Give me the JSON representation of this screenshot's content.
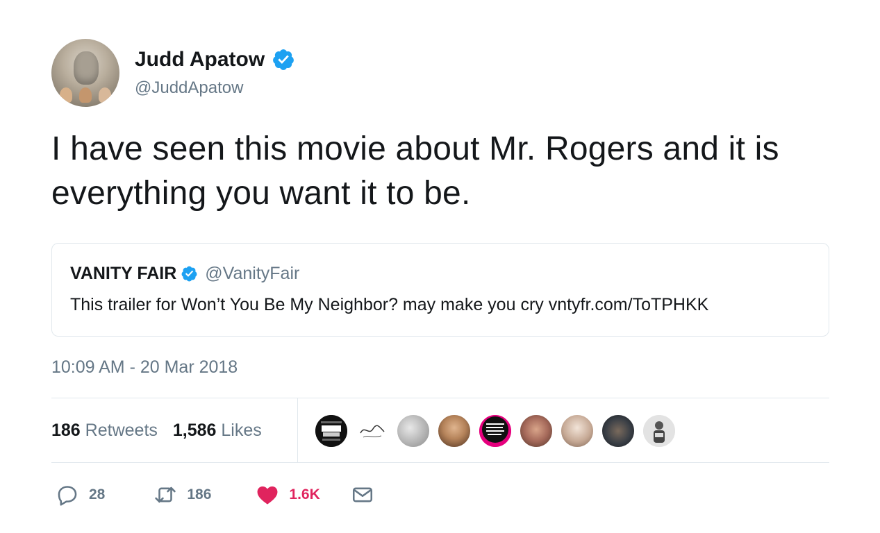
{
  "author": {
    "name": "Judd Apatow",
    "handle": "@JuddApatow",
    "verified": true
  },
  "tweet": {
    "text": "I have seen this movie about Mr. Rogers and it is everything you want it to be."
  },
  "quoted_tweet": {
    "name": "VANITY FAIR",
    "handle": "@VanityFair",
    "verified": true,
    "text": "This trailer for Won’t You Be My Neighbor? may make you cry vntyfr.com/ToTPHKK"
  },
  "timestamp": "10:09 AM - 20 Mar 2018",
  "stats": {
    "retweets_count": "186",
    "retweets_label": "Retweets",
    "likes_count": "1,586",
    "likes_label": "Likes"
  },
  "likers": [
    {
      "id": "salem",
      "icon": "salem-cinema-logo",
      "color": "#111111"
    },
    {
      "id": "signature",
      "icon": "signature-logo",
      "color": "#ffffff"
    },
    {
      "id": "p3",
      "icon": "user-avatar",
      "color": "#9a9a9a"
    },
    {
      "id": "p4",
      "icon": "user-avatar",
      "color": "#b5835a"
    },
    {
      "id": "p5",
      "icon": "text-avatar",
      "color": "#e6007e"
    },
    {
      "id": "p6",
      "icon": "user-avatar",
      "color": "#a5695a"
    },
    {
      "id": "p7",
      "icon": "user-avatar",
      "color": "#c6a995"
    },
    {
      "id": "p8",
      "icon": "user-avatar",
      "color": "#3a3f46"
    },
    {
      "id": "p9",
      "icon": "user-avatar",
      "color": "#d9d9d9"
    }
  ],
  "actions": {
    "replies": "28",
    "retweets": "186",
    "likes": "1.6K"
  },
  "colors": {
    "text": "#14171a",
    "secondary": "#657786",
    "border": "#e1e8ed",
    "verified": "#1da1f2",
    "like": "#e0245e"
  }
}
